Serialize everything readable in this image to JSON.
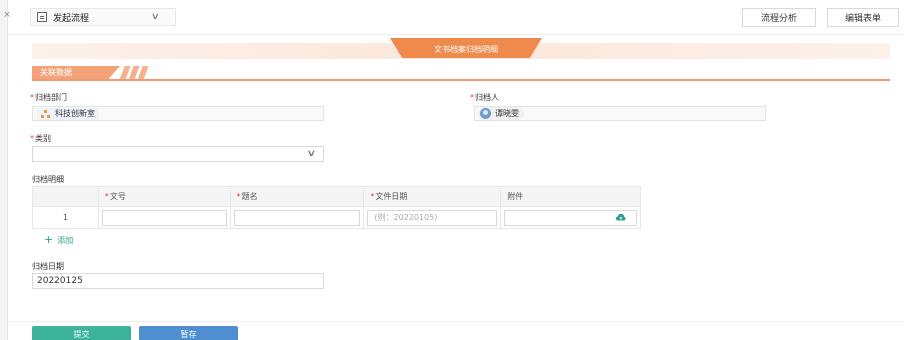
{
  "close_label": "×",
  "header": {
    "flow_select": "发起流程",
    "buttons": {
      "analysis": "流程分析",
      "edit_form": "编辑表单"
    }
  },
  "form": {
    "title": "文书档案归档明细",
    "section": "关联数据",
    "dept_label": "归档部门",
    "dept_value": "科技创新室",
    "archiver_label": "归档人",
    "archiver_value": "谭晓雯",
    "category_label": "类别",
    "category_value": "",
    "details_label": "归档明细",
    "table": {
      "columns": [
        "文号",
        "题名",
        "文件日期",
        "附件"
      ],
      "rows": [
        {
          "index": "1",
          "doc_no": "",
          "title": "",
          "file_date_placeholder": "(例：20220105)",
          "attachment": ""
        }
      ]
    },
    "add_label": "添加",
    "archive_date_label": "归档日期",
    "archive_date_value": "20220125"
  },
  "footer": {
    "submit": "提交",
    "save": "暂存"
  },
  "colors": {
    "accent": "#ee8a4b",
    "submit": "#3eb39c",
    "save": "#4f8fd0",
    "required": "#e54545"
  },
  "icons": [
    "close-icon",
    "document-icon",
    "chevron-down-icon",
    "org-icon",
    "user-avatar-icon",
    "upload-cloud-icon",
    "plus-icon"
  ]
}
